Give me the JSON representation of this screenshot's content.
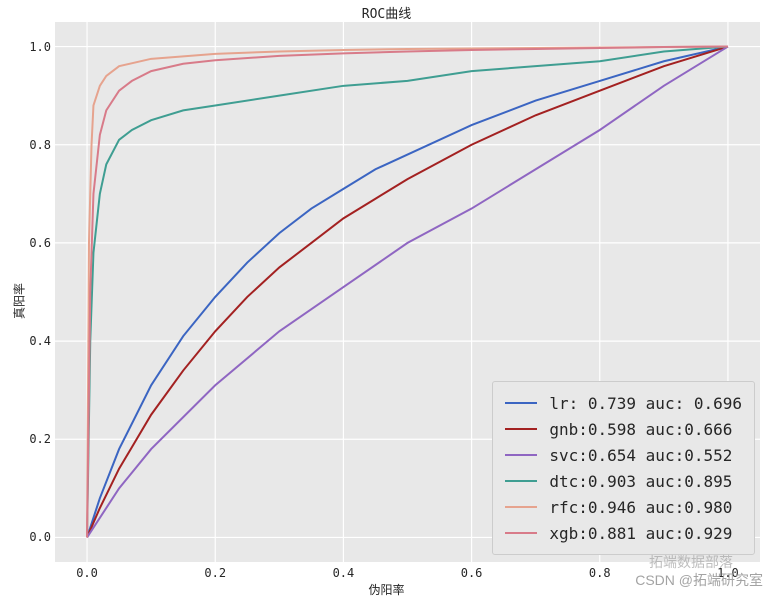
{
  "chart_data": {
    "type": "line",
    "title": "ROC曲线",
    "xlabel": "伪阳率",
    "ylabel": "真阳率",
    "xlim": [
      -0.05,
      1.05
    ],
    "ylim": [
      -0.05,
      1.05
    ],
    "x_ticks": [
      0.0,
      0.2,
      0.4,
      0.6,
      0.8,
      1.0
    ],
    "y_ticks": [
      0.0,
      0.2,
      0.4,
      0.6,
      0.8,
      1.0
    ],
    "legend_position": "lower right",
    "series": [
      {
        "name": "lr",
        "accuracy": 0.739,
        "auc": 0.696,
        "color": "#3b65c2",
        "x": [
          0.0,
          0.02,
          0.05,
          0.1,
          0.15,
          0.2,
          0.25,
          0.3,
          0.35,
          0.4,
          0.45,
          0.5,
          0.6,
          0.7,
          0.8,
          0.9,
          1.0
        ],
        "y": [
          0.0,
          0.08,
          0.18,
          0.31,
          0.41,
          0.49,
          0.56,
          0.62,
          0.67,
          0.71,
          0.75,
          0.78,
          0.84,
          0.89,
          0.93,
          0.97,
          1.0
        ]
      },
      {
        "name": "gnb",
        "accuracy": 0.598,
        "auc": 0.666,
        "color": "#a32121",
        "x": [
          0.0,
          0.02,
          0.05,
          0.1,
          0.15,
          0.2,
          0.25,
          0.3,
          0.35,
          0.4,
          0.45,
          0.5,
          0.6,
          0.7,
          0.8,
          0.9,
          1.0
        ],
        "y": [
          0.0,
          0.06,
          0.14,
          0.25,
          0.34,
          0.42,
          0.49,
          0.55,
          0.6,
          0.65,
          0.69,
          0.73,
          0.8,
          0.86,
          0.91,
          0.96,
          1.0
        ]
      },
      {
        "name": "svc",
        "accuracy": 0.654,
        "auc": 0.552,
        "color": "#8f66c2",
        "x": [
          0.0,
          0.05,
          0.1,
          0.2,
          0.3,
          0.4,
          0.5,
          0.6,
          0.7,
          0.8,
          0.9,
          1.0
        ],
        "y": [
          0.0,
          0.1,
          0.18,
          0.31,
          0.42,
          0.51,
          0.6,
          0.67,
          0.75,
          0.83,
          0.92,
          1.0
        ]
      },
      {
        "name": "dtc",
        "accuracy": 0.903,
        "auc": 0.895,
        "color": "#3f9e92",
        "x": [
          0.0,
          0.005,
          0.01,
          0.02,
          0.03,
          0.05,
          0.07,
          0.1,
          0.15,
          0.2,
          0.3,
          0.4,
          0.5,
          0.6,
          0.7,
          0.8,
          0.9,
          1.0
        ],
        "y": [
          0.0,
          0.4,
          0.58,
          0.7,
          0.76,
          0.81,
          0.83,
          0.85,
          0.87,
          0.88,
          0.9,
          0.92,
          0.93,
          0.95,
          0.96,
          0.97,
          0.99,
          1.0
        ]
      },
      {
        "name": "rfc",
        "accuracy": 0.946,
        "auc": 0.98,
        "color": "#e6a38e",
        "x": [
          0.0,
          0.003,
          0.007,
          0.01,
          0.02,
          0.03,
          0.05,
          0.1,
          0.15,
          0.2,
          0.3,
          0.4,
          0.5,
          0.6,
          0.7,
          0.8,
          0.9,
          1.0
        ],
        "y": [
          0.0,
          0.6,
          0.8,
          0.88,
          0.92,
          0.94,
          0.96,
          0.975,
          0.98,
          0.985,
          0.99,
          0.993,
          0.995,
          0.996,
          0.997,
          0.998,
          0.999,
          1.0
        ]
      },
      {
        "name": "xgb",
        "accuracy": 0.881,
        "auc": 0.929,
        "color": "#d87b89",
        "x": [
          0.0,
          0.005,
          0.01,
          0.02,
          0.03,
          0.05,
          0.07,
          0.1,
          0.15,
          0.2,
          0.3,
          0.4,
          0.5,
          0.6,
          0.7,
          0.8,
          0.9,
          1.0
        ],
        "y": [
          0.0,
          0.5,
          0.7,
          0.82,
          0.87,
          0.91,
          0.93,
          0.95,
          0.965,
          0.972,
          0.981,
          0.986,
          0.99,
          0.993,
          0.995,
          0.997,
          0.999,
          1.0
        ]
      }
    ]
  },
  "legend_labels": [
    "lr: 0.739 auc: 0.696",
    "gnb:0.598 auc:0.666",
    "svc:0.654 auc:0.552",
    "dtc:0.903 auc:0.895",
    "rfc:0.946 auc:0.980",
    "xgb:0.881 auc:0.929"
  ],
  "watermark_main": "CSDN @拓端研究室",
  "watermark_sub": "拓端数据部落"
}
